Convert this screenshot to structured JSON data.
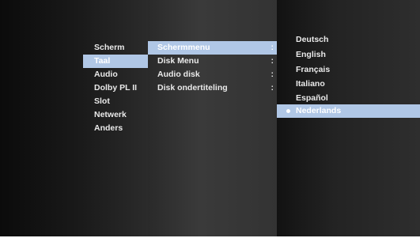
{
  "menu_main": {
    "items": [
      "Scherm",
      "Taal",
      "Audio",
      "Dolby PL II",
      "Slot",
      "Netwerk",
      "Anders"
    ],
    "selected_index": 1
  },
  "menu_sub": {
    "items": [
      {
        "label": "Schermmenu",
        "sep": ":"
      },
      {
        "label": "Disk Menu",
        "sep": ":"
      },
      {
        "label": "Audio disk",
        "sep": ":"
      },
      {
        "label": "Disk ondertiteling",
        "sep": ":"
      }
    ],
    "selected_index": 0
  },
  "menu_options": {
    "items": [
      "Deutsch",
      "English",
      "Français",
      "Italiano",
      "Español",
      "Nederlands"
    ],
    "selected_index": 5,
    "checked_index": 5
  },
  "colors": {
    "highlight": "#b0c7e6",
    "text": "#eaeaea",
    "background": "#0d0d0d"
  }
}
